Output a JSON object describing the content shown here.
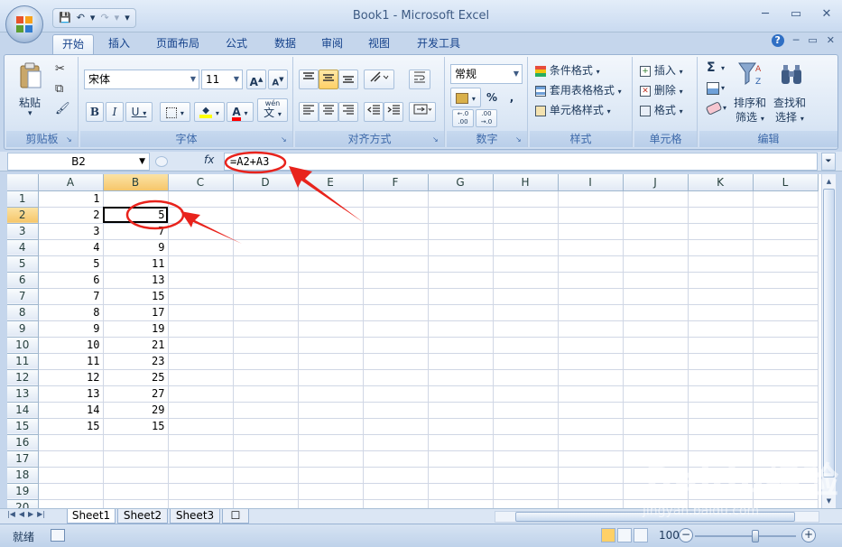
{
  "window": {
    "title": "Book1 - Microsoft Excel"
  },
  "qat": {
    "save": "💾",
    "undo": "↶",
    "undo_drop": "▾",
    "redo": "↷",
    "redo_drop": "▾",
    "customize": "▾"
  },
  "window_controls": {
    "minimize": "─",
    "restore": "▭",
    "close": "✕"
  },
  "tabs": [
    {
      "label": "开始",
      "active": true
    },
    {
      "label": "插入"
    },
    {
      "label": "页面布局"
    },
    {
      "label": "公式"
    },
    {
      "label": "数据"
    },
    {
      "label": "审阅"
    },
    {
      "label": "视图"
    },
    {
      "label": "开发工具"
    }
  ],
  "help_controls": {
    "help": "?",
    "minimize": "─",
    "restore": "▭",
    "close": "✕"
  },
  "ribbon": {
    "clipboard": {
      "label": "剪贴板",
      "paste": "粘贴",
      "paste_drop": "▾",
      "cut": "✂",
      "copy": "⧉",
      "format_painter": "🖌"
    },
    "font": {
      "label": "字体",
      "font_name": "宋体",
      "font_size": "11",
      "grow": "A",
      "shrink": "A",
      "bold": "B",
      "italic": "I",
      "underline": "U",
      "underline_drop": "▾",
      "border_drop": "▾",
      "fill_drop": "▾",
      "color": "A",
      "color_drop": "▾",
      "phonetic": "wén",
      "phonetic_sub": "文",
      "phonetic_drop": "▾"
    },
    "alignment": {
      "label": "对齐方式"
    },
    "number": {
      "label": "数字",
      "format": "常规",
      "percent": "%",
      "comma": ",",
      "inc_decimal": ".00",
      "inc_decimal_sub": "←.0",
      "dec_decimal": ".00",
      "dec_decimal_sub": "→.0",
      "currency_drop": "▾"
    },
    "styles": {
      "label": "样式",
      "conditional": "条件格式",
      "format_table": "套用表格格式",
      "cell_styles": "单元格样式",
      "drop": "▾"
    },
    "cells": {
      "label": "单元格",
      "insert": "插入",
      "delete": "删除",
      "format": "格式",
      "drop": "▾"
    },
    "editing": {
      "label": "编辑",
      "sum": "Σ",
      "sort1": "排序和",
      "sort2": "筛选",
      "find1": "查找和",
      "find2": "选择",
      "drop": "▾"
    }
  },
  "formula_bar": {
    "name_box": "B2",
    "fx": "fx",
    "formula": "=A2+A3",
    "expand": "¥"
  },
  "grid": {
    "columns": [
      "A",
      "B",
      "C",
      "D",
      "E",
      "F",
      "G",
      "H",
      "I",
      "J",
      "K",
      "L"
    ],
    "rows": [
      {
        "n": "1",
        "a": "1",
        "b": ""
      },
      {
        "n": "2",
        "a": "2",
        "b": "5"
      },
      {
        "n": "3",
        "a": "3",
        "b": "7"
      },
      {
        "n": "4",
        "a": "4",
        "b": "9"
      },
      {
        "n": "5",
        "a": "5",
        "b": "11"
      },
      {
        "n": "6",
        "a": "6",
        "b": "13"
      },
      {
        "n": "7",
        "a": "7",
        "b": "15"
      },
      {
        "n": "8",
        "a": "8",
        "b": "17"
      },
      {
        "n": "9",
        "a": "9",
        "b": "19"
      },
      {
        "n": "10",
        "a": "10",
        "b": "21"
      },
      {
        "n": "11",
        "a": "11",
        "b": "23"
      },
      {
        "n": "12",
        "a": "12",
        "b": "25"
      },
      {
        "n": "13",
        "a": "13",
        "b": "27"
      },
      {
        "n": "14",
        "a": "14",
        "b": "29"
      },
      {
        "n": "15",
        "a": "15",
        "b": "15"
      },
      {
        "n": "16",
        "a": "",
        "b": ""
      },
      {
        "n": "17",
        "a": "",
        "b": ""
      },
      {
        "n": "18",
        "a": "",
        "b": ""
      },
      {
        "n": "19",
        "a": "",
        "b": ""
      },
      {
        "n": "20",
        "a": "",
        "b": ""
      }
    ]
  },
  "sheets": [
    {
      "label": "Sheet1",
      "active": true
    },
    {
      "label": "Sheet2"
    },
    {
      "label": "Sheet3"
    }
  ],
  "status": {
    "text": "就绪",
    "zoom": "100%",
    "zoom_out": "−",
    "zoom_in": "+"
  },
  "watermark": {
    "text": "Baidu经验",
    "sub": "jingyan.baidu.com"
  },
  "colors": {
    "accent": "#15428b",
    "annotation": "#e8231c",
    "selected_header": "#f6c66a"
  }
}
